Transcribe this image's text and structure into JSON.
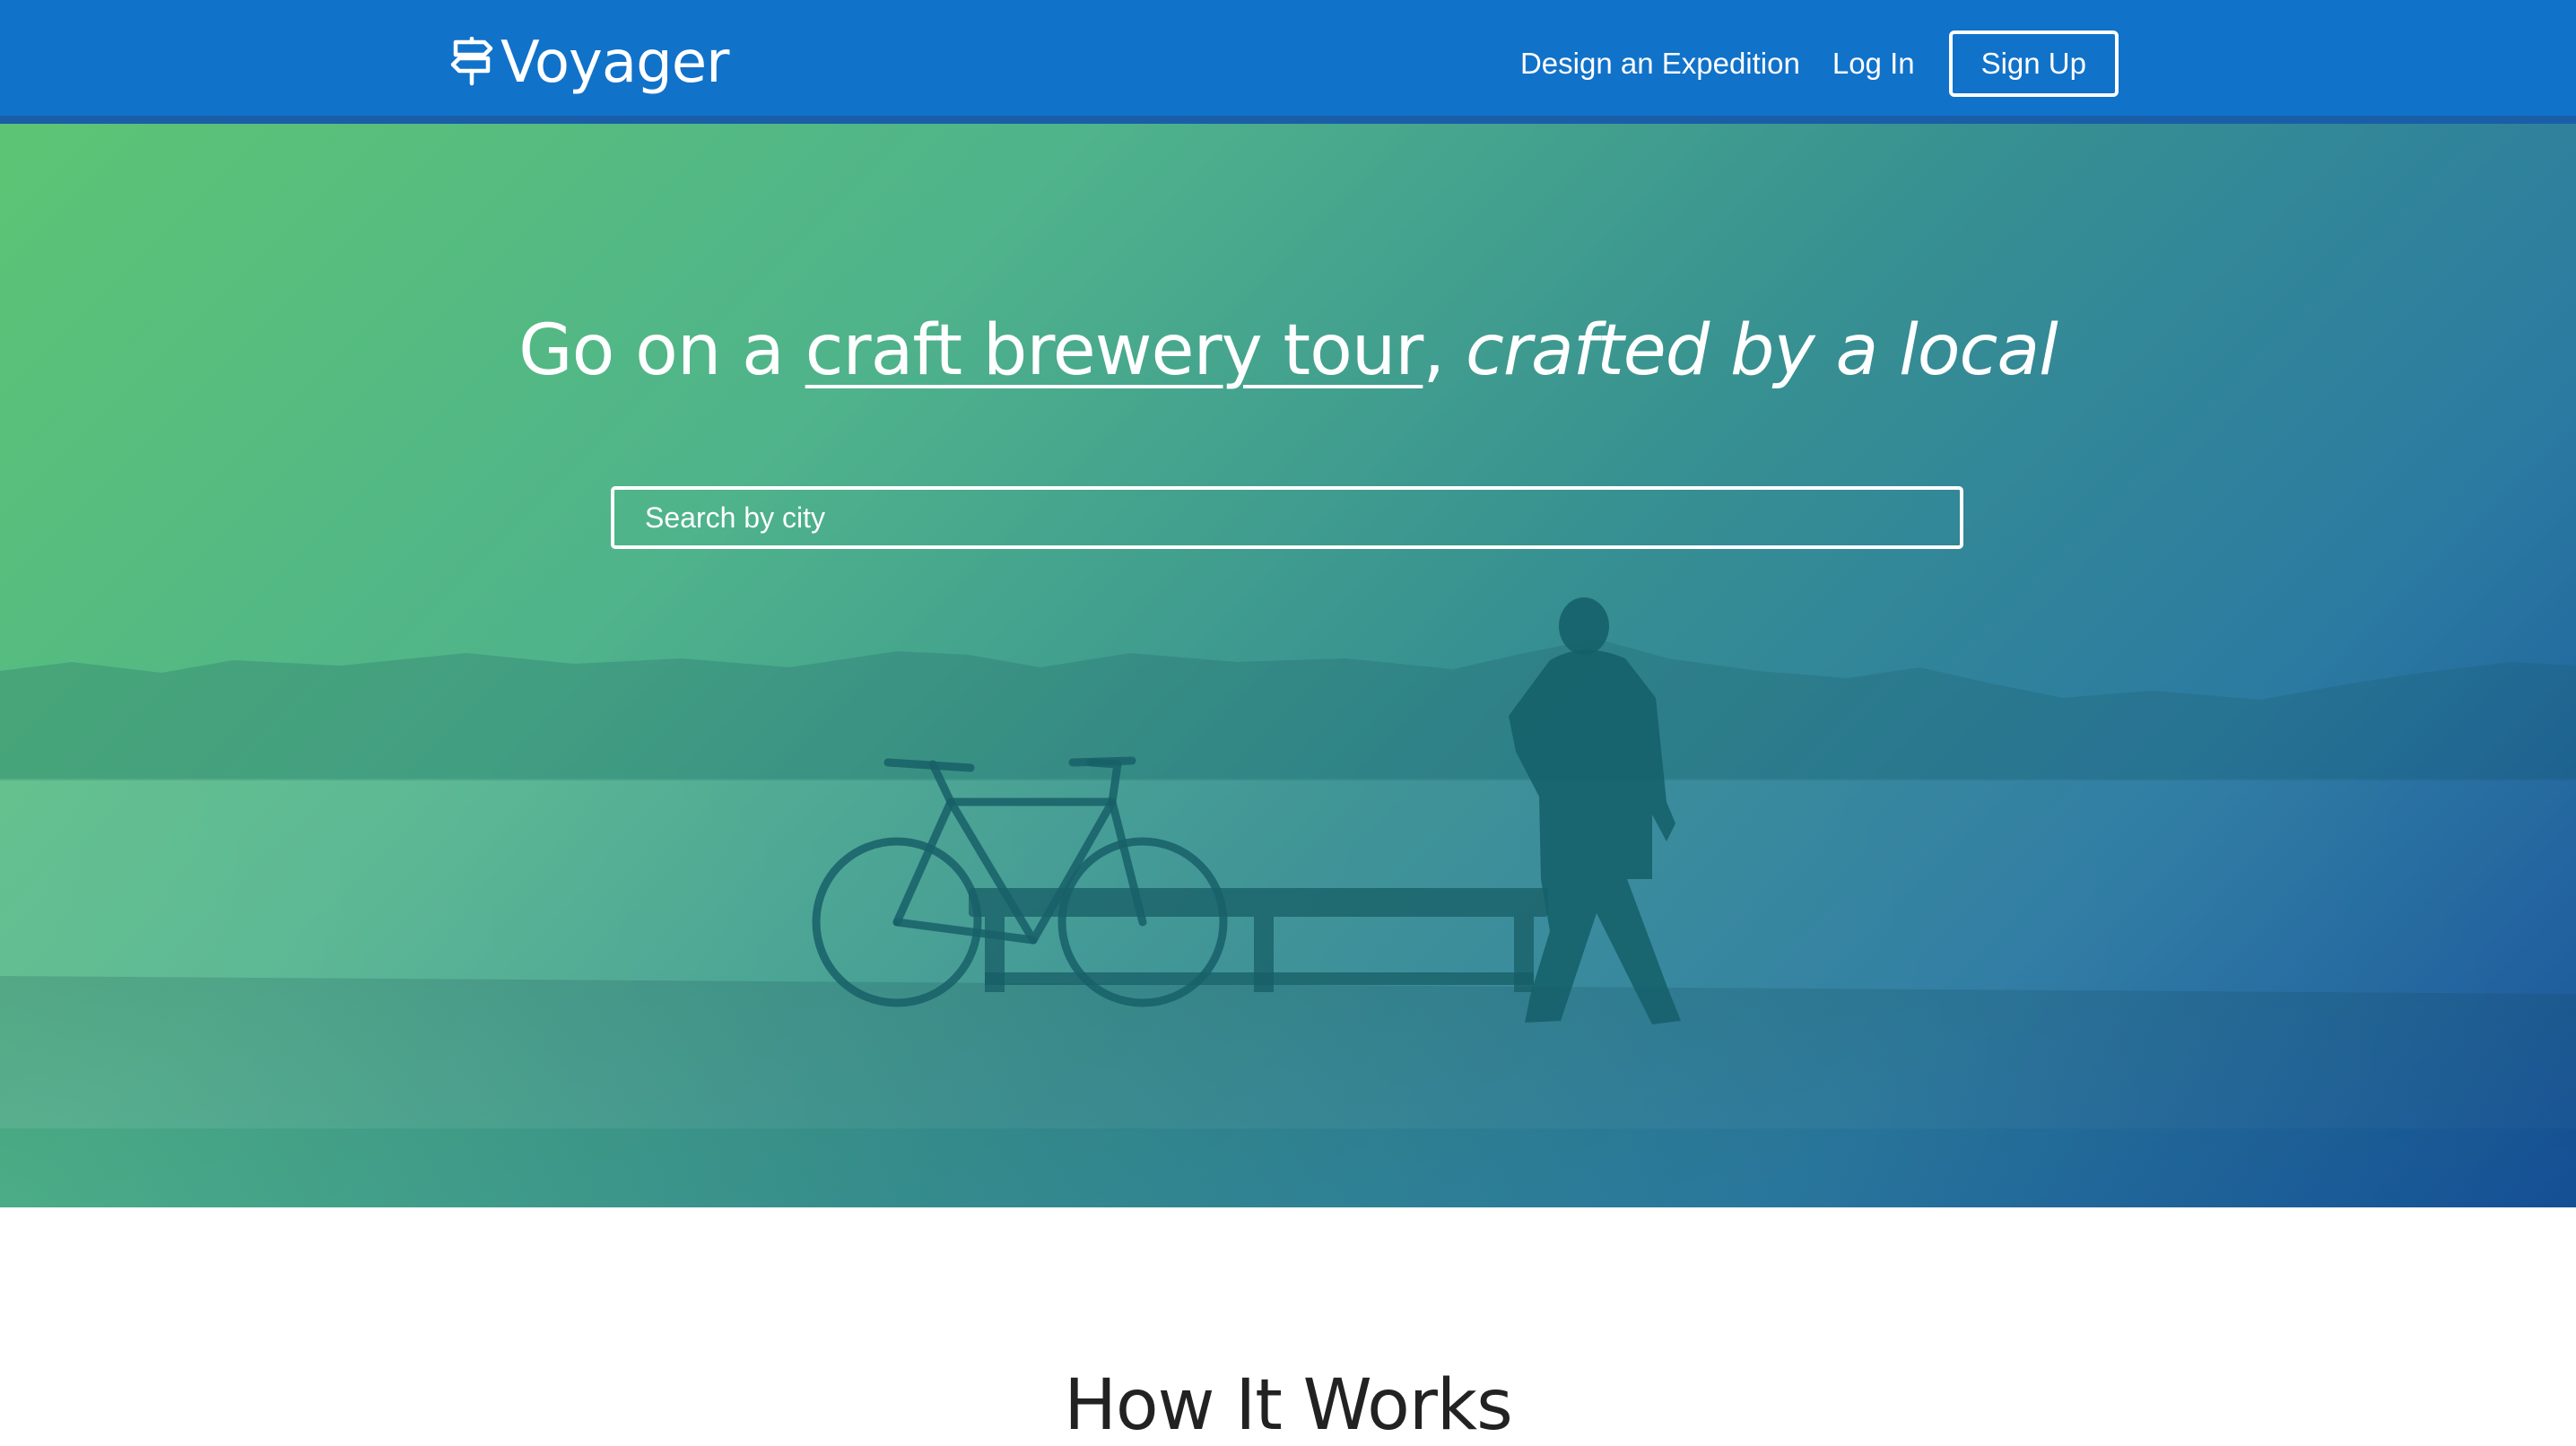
{
  "colors": {
    "nav_bg": "#1172c9",
    "nav_border": "#1a5ea8",
    "hero_gradient_start": "#5cc574",
    "hero_gradient_end": "#15509a",
    "text_light": "#ffffff",
    "text_dark": "#222222"
  },
  "navbar": {
    "brand_icon": "signpost-icon",
    "brand_name": "Voyager",
    "links": {
      "design": "Design an Expedition",
      "login": "Log In",
      "signup": "Sign Up"
    }
  },
  "hero": {
    "headline_prefix": "Go on a ",
    "headline_link": "craft brewery tour",
    "headline_comma": ", ",
    "headline_emphasis": "crafted by a local",
    "search": {
      "placeholder": "Search by city",
      "value": ""
    }
  },
  "how_it_works": {
    "title": "How It Works"
  }
}
